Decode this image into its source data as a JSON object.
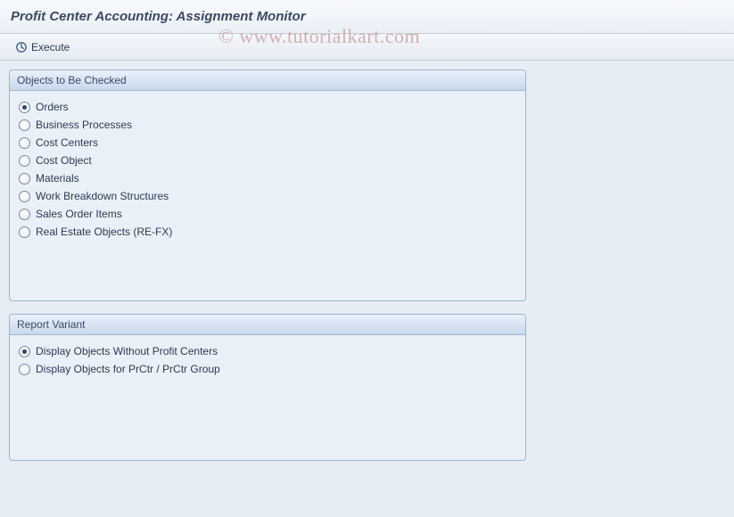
{
  "title": "Profit Center Accounting: Assignment Monitor",
  "toolbar": {
    "execute_label": "Execute"
  },
  "watermark": "© www.tutorialkart.com",
  "groups": {
    "objects": {
      "title": "Objects to Be Checked",
      "options": [
        {
          "label": "Orders",
          "checked": true
        },
        {
          "label": "Business Processes",
          "checked": false
        },
        {
          "label": "Cost Centers",
          "checked": false
        },
        {
          "label": "Cost Object",
          "checked": false
        },
        {
          "label": "Materials",
          "checked": false
        },
        {
          "label": "Work Breakdown Structures",
          "checked": false
        },
        {
          "label": "Sales Order Items",
          "checked": false
        },
        {
          "label": "Real Estate Objects (RE-FX)",
          "checked": false
        }
      ]
    },
    "variant": {
      "title": "Report Variant",
      "options": [
        {
          "label": "Display Objects Without Profit Centers",
          "checked": true
        },
        {
          "label": "Display Objects for PrCtr / PrCtr Group",
          "checked": false
        }
      ]
    }
  }
}
